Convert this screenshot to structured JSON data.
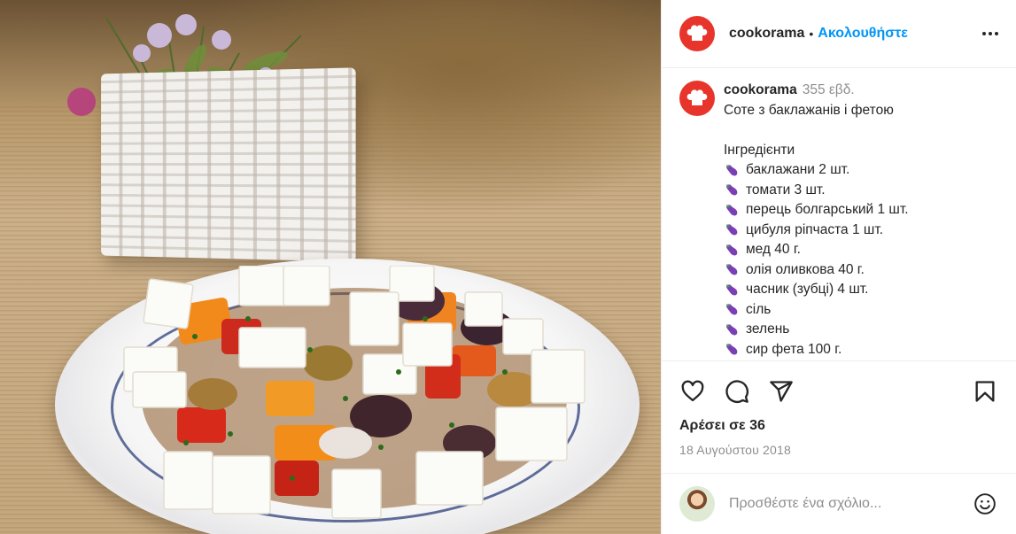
{
  "post": {
    "username": "cookorama",
    "separator": "•",
    "follow_label": "Ακολουθήστε",
    "caption": {
      "username": "cookorama",
      "time_ago": "355 εβδ.",
      "title": "Соте з баклажанів і фетою",
      "ingredients_heading": "Інгредієнти",
      "ingredients": [
        "баклажани 2 шт.",
        "томати 3 шт.",
        "перець болгарський 1 шт.",
        "цибуля ріпчаста 1 шт.",
        "мед 40 г.",
        "олія оливкова 40 г.",
        "часник (зубці) 4 шт.",
        "сіль",
        "зелень",
        "сир фета 100 г."
      ]
    },
    "likes_text": "Αρέσει σε 36",
    "date_text": "18 Αυγούστου 2018",
    "comment": {
      "placeholder": "Προσθέστε ένα σχόλιο..."
    }
  },
  "icons": {
    "like": "heart-icon",
    "comment": "comment-bubble-icon",
    "share": "paper-plane-icon",
    "save": "bookmark-icon",
    "more": "more-dots-icon",
    "emoji": "emoji-smile-icon",
    "bullet": "eggplant-emoji"
  },
  "colors": {
    "brand_avatar": "#e8352c",
    "follow": "#0095f6",
    "muted": "#8e8e8e",
    "text": "#262626",
    "eggplant": "#7b3fb5"
  }
}
